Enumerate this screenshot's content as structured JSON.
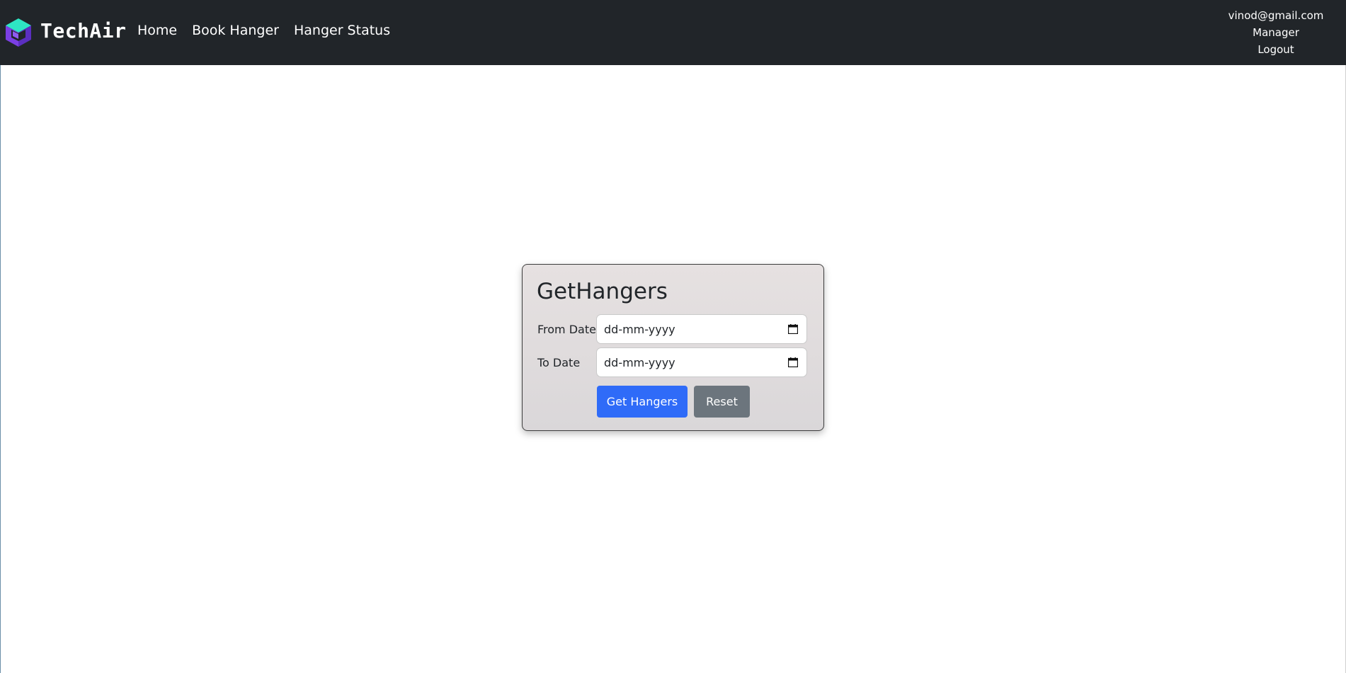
{
  "navbar": {
    "brand": "TechAir",
    "links": [
      {
        "label": "Home"
      },
      {
        "label": "Book Hanger"
      },
      {
        "label": "Hanger Status"
      }
    ],
    "user": {
      "email": "vinod@gmail.com",
      "role": "Manager",
      "logout": "Logout"
    }
  },
  "form": {
    "title": "GetHangers",
    "from_date": {
      "label": "From Date",
      "placeholder": "dd-mm-yyyy"
    },
    "to_date": {
      "label": "To Date",
      "placeholder": "dd-mm-yyyy"
    },
    "submit_label": "Get Hangers",
    "reset_label": "Reset"
  },
  "colors": {
    "navbar_bg": "#212529",
    "primary": "#2f6bf8",
    "secondary": "#6c757d",
    "logo_teal": "#2ee6c3",
    "logo_purple": "#7b3fe4"
  },
  "icons": {
    "logo": "cube-logo-icon",
    "date_picker": "calendar-icon"
  }
}
